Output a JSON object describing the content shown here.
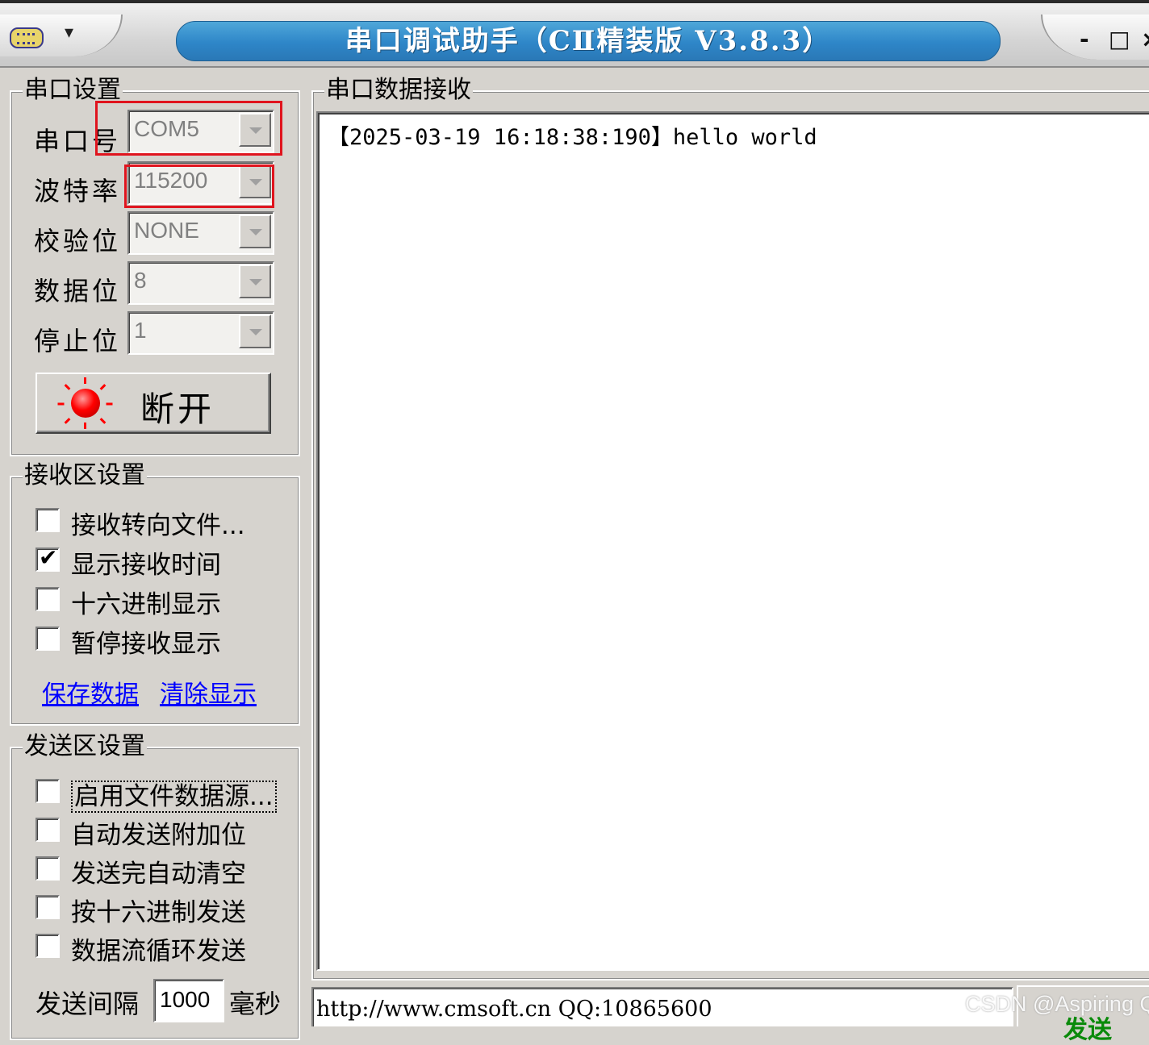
{
  "window": {
    "title": "串口调试助手（CⅡ精装版 V3.8.3）",
    "minimize": "-",
    "maximize": "□",
    "close": "×"
  },
  "serial_settings": {
    "legend": "串口设置",
    "port_label": "串口号",
    "port_value": "COM5",
    "baud_label": "波特率",
    "baud_value": "115200",
    "parity_label": "校验位",
    "parity_value": "NONE",
    "databits_label": "数据位",
    "databits_value": "8",
    "stopbits_label": "停止位",
    "stopbits_value": "1",
    "connect_button": "断开",
    "led_color": "#ff0000",
    "highlight_color": "#e0141e"
  },
  "receive_settings": {
    "legend": "接收区设置",
    "options": [
      {
        "label": "接收转向文件...",
        "checked": false
      },
      {
        "label": "显示接收时间",
        "checked": true
      },
      {
        "label": "十六进制显示",
        "checked": false
      },
      {
        "label": "暂停接收显示",
        "checked": false
      }
    ],
    "save_link": "保存数据",
    "clear_link": "清除显示"
  },
  "send_settings": {
    "legend": "发送区设置",
    "options": [
      {
        "label": "启用文件数据源...",
        "checked": false
      },
      {
        "label": "自动发送附加位",
        "checked": false
      },
      {
        "label": "发送完自动清空",
        "checked": false
      },
      {
        "label": "按十六进制发送",
        "checked": false
      },
      {
        "label": "数据流循环发送",
        "checked": false
      }
    ],
    "interval_label": "发送间隔",
    "interval_value": "1000",
    "interval_unit": "毫秒"
  },
  "receive_area": {
    "legend": "串口数据接收",
    "lines": [
      "【2025-03-19 16:18:38:190】hello world"
    ]
  },
  "status_bar": {
    "text": "http://www.cmsoft.cn QQ:10865600",
    "send_button": "发送"
  },
  "watermark": "CSDN @Aspiring Q"
}
